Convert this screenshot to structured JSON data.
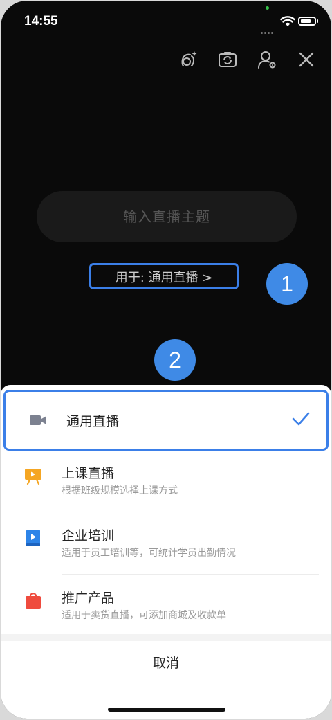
{
  "status_bar": {
    "time": "14:55"
  },
  "live_setup": {
    "topic_placeholder": "输入直播主题",
    "usage_label": "用于: 通用直播 >"
  },
  "badges": [
    "1",
    "2"
  ],
  "sheet": {
    "options": [
      {
        "title": "通用直播",
        "desc": "",
        "icon": "video-camera-icon",
        "selected": true
      },
      {
        "title": "上课直播",
        "desc": "根据班级规模选择上课方式",
        "icon": "presentation-board-icon",
        "color": "#f5a623"
      },
      {
        "title": "企业培训",
        "desc": "适用于员工培训等，可统计学员出勤情况",
        "icon": "play-book-icon",
        "color": "#2d84e8"
      },
      {
        "title": "推广产品",
        "desc": "适用于卖货直播，可添加商城及收款单",
        "icon": "shopping-bag-icon",
        "color": "#ef4b3e"
      }
    ],
    "cancel_label": "取消"
  },
  "colors": {
    "accent": "#3b7fe8",
    "badge": "#3f8ae6"
  }
}
